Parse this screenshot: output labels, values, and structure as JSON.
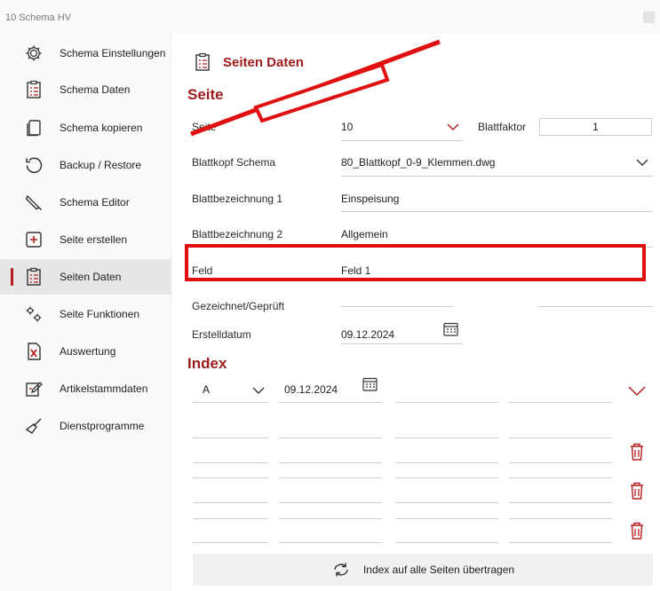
{
  "window": {
    "title": "10 Schema HV"
  },
  "sidebar": {
    "items": [
      {
        "label": "Schema Einstellungen",
        "icon": "gear-icon",
        "active": false
      },
      {
        "label": "Schema Daten",
        "icon": "clipboard-list-icon",
        "active": false
      },
      {
        "label": "Schema kopieren",
        "icon": "copy-icon",
        "active": false
      },
      {
        "label": "Backup / Restore",
        "icon": "restore-icon",
        "active": false
      },
      {
        "label": "Schema Editor",
        "icon": "pencil-icon",
        "active": false
      },
      {
        "label": "Seite erstellen",
        "icon": "add-page-icon",
        "active": false
      },
      {
        "label": "Seiten Daten",
        "icon": "clipboard-list-icon",
        "active": true
      },
      {
        "label": "Seite Funktionen",
        "icon": "gears-icon",
        "active": false
      },
      {
        "label": "Auswertung",
        "icon": "excel-icon",
        "active": false
      },
      {
        "label": "Artikelstammdaten",
        "icon": "edit-document-icon",
        "active": false
      },
      {
        "label": "Dienstprogramme",
        "icon": "broom-icon",
        "active": false
      }
    ]
  },
  "main": {
    "title": "Seiten Daten",
    "seite_section": "Seite",
    "fields": {
      "seite": {
        "label": "Seite",
        "value": "10"
      },
      "blattfaktor": {
        "label": "Blattfaktor",
        "value": "1"
      },
      "blattkopf": {
        "label": "Blattkopf Schema",
        "value": "80_Blattkopf_0-9_Klemmen.dwg"
      },
      "blattbez1": {
        "label": "Blattbezeichnung 1",
        "value": "Einspeisung"
      },
      "blattbez2": {
        "label": "Blattbezeichnung 2",
        "value": "Allgemein"
      },
      "feld": {
        "label": "Feld",
        "value": "Feld 1"
      },
      "gezeichnet": {
        "label": "Gezeichnet/Geprüft",
        "value": ""
      },
      "erstelldatum": {
        "label": "Erstelldatum",
        "value": "09.12.2024"
      }
    },
    "index_section": "Index",
    "index_first": {
      "rev": "A",
      "date": "09.12.2024"
    },
    "transfer_button": "Index auf alle Seiten übertragen"
  },
  "colors": {
    "accent": "#9d1b1b",
    "annotation": "#e01010"
  }
}
